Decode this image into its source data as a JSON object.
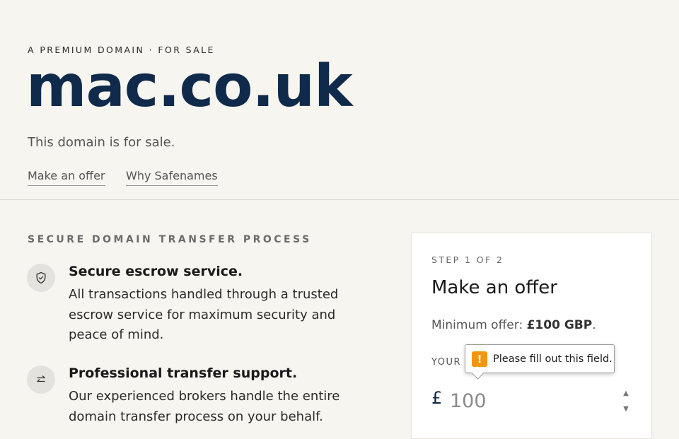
{
  "hero": {
    "eyebrow": "A PREMIUM DOMAIN · FOR SALE",
    "domain": "mac.co.uk",
    "tagline": "This domain is for sale.",
    "links": [
      "Make an offer",
      "Why Safenames"
    ]
  },
  "process": {
    "title": "SECURE DOMAIN TRANSFER PROCESS",
    "features": [
      {
        "icon": "shield-check-icon",
        "title": "Secure escrow service.",
        "desc": "All transactions handled through a trusted escrow service for maximum security and peace of mind."
      },
      {
        "icon": "transfer-arrows-icon",
        "title": "Professional transfer support.",
        "desc": "Our experienced brokers handle the entire domain transfer process on your behalf."
      }
    ]
  },
  "offer_card": {
    "step": "STEP 1 OF 2",
    "title": "Make an offer",
    "min_offer_prefix": "Minimum offer: ",
    "min_offer_amount": "£100 GBP",
    "min_offer_suffix": ".",
    "your_label": "YOUR OFFER",
    "currency_symbol": "£",
    "offer_input": {
      "value": "",
      "placeholder": "100"
    }
  },
  "validation_tooltip": {
    "icon": "warning-icon",
    "message": "Please fill out this field."
  },
  "colors": {
    "background": "#f7f5f0",
    "brand_navy": "#0f2a4a",
    "warning": "#f3960c"
  }
}
